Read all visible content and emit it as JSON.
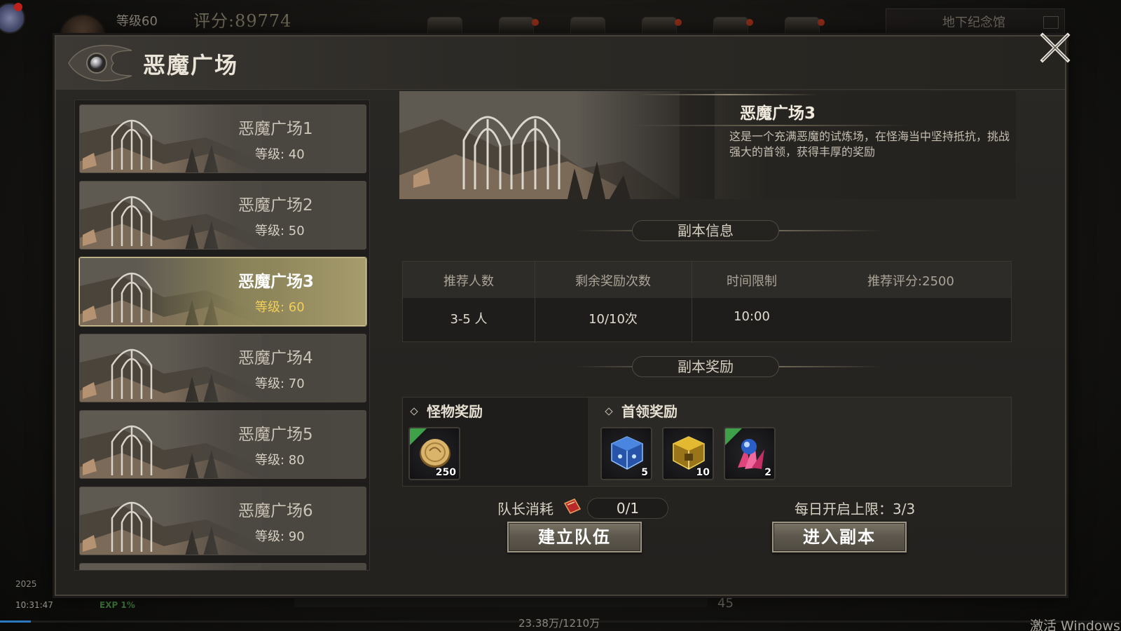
{
  "hud": {
    "level": "等级60",
    "score": "评分:89774",
    "location": "地下纪念馆",
    "date": "2025",
    "time": "10:31:47",
    "exp": "EXP 1%",
    "gold": "45",
    "money": "23.38万/1210万",
    "windows_activation": "激活 Windows"
  },
  "panel": {
    "title": "恶魔广场",
    "close_icon": "close-x-icon"
  },
  "dungeon_list": [
    {
      "name": "恶魔广场1",
      "level": "等级: 40"
    },
    {
      "name": "恶魔广场2",
      "level": "等级: 50"
    },
    {
      "name": "恶魔广场3",
      "level": "等级: 60",
      "selected": true
    },
    {
      "name": "恶魔广场4",
      "level": "等级: 70"
    },
    {
      "name": "恶魔广场5",
      "level": "等级: 80"
    },
    {
      "name": "恶魔广场6",
      "level": "等级: 90"
    }
  ],
  "detail": {
    "title": "恶魔广场3",
    "description": "这是一个充满恶魔的试炼场，在怪海当中坚持抵抗，挑战强大的首领，获得丰厚的奖励",
    "info_section": "副本信息",
    "info_headers": [
      "推荐人数",
      "剩余奖励次数",
      "时间限制",
      "推荐评分:2500"
    ],
    "info_values": [
      "3-5 人",
      "10/10次",
      "10:00"
    ],
    "reward_section": "副本奖励",
    "monster_reward_title": "怪物奖励",
    "boss_reward_title": "首领奖励",
    "monster_rewards": [
      {
        "icon": "gold-coin-icon",
        "qty": "250"
      }
    ],
    "boss_rewards": [
      {
        "icon": "blue-gem-chest-icon",
        "qty": "5"
      },
      {
        "icon": "gold-chest-icon",
        "qty": "10"
      },
      {
        "icon": "pink-crystal-orb-icon",
        "qty": "2"
      }
    ],
    "captain_cost_label": "队长消耗",
    "captain_cost_value": "0/1",
    "daily_limit": "每日开启上限：3/3",
    "create_team_button": "建立队伍",
    "enter_dungeon_button": "进入副本"
  },
  "colors": {
    "selected_level": "#f2cf59",
    "selected_item_bg": "#a69c6c",
    "panel_bg": "#24221f",
    "reward_corner": "#3fa04a"
  }
}
